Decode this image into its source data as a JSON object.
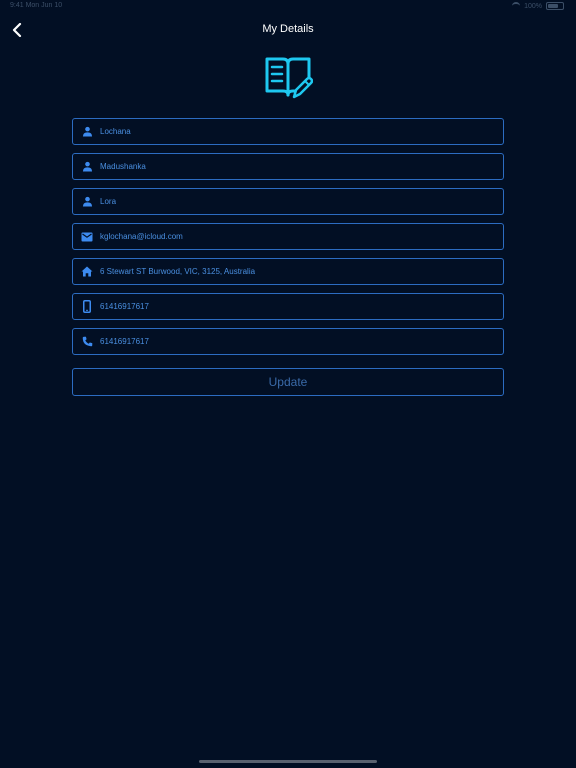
{
  "status_bar": {
    "left_text": "9:41 Mon Jun 10",
    "battery_text": "100%"
  },
  "header": {
    "title": "My Details"
  },
  "form": {
    "fields": [
      {
        "icon": "person-icon",
        "value": "Lochana"
      },
      {
        "icon": "person-icon",
        "value": "Madushanka"
      },
      {
        "icon": "person-icon",
        "value": "Lora"
      },
      {
        "icon": "email-icon",
        "value": "kglochana@icloud.com"
      },
      {
        "icon": "home-icon",
        "value": "6 Stewart ST Burwood, VIC, 3125, Australia"
      },
      {
        "icon": "mobile-phone-icon",
        "value": "61416917617"
      },
      {
        "icon": "phone-icon",
        "value": "61416917617"
      }
    ],
    "update_label": "Update"
  },
  "colors": {
    "background": "#020f24",
    "field_border": "#2c6cc2",
    "field_text": "#4a8fe0",
    "icon_blue": "#3d8bf0",
    "logo_cyan": "#1ec8f0"
  }
}
